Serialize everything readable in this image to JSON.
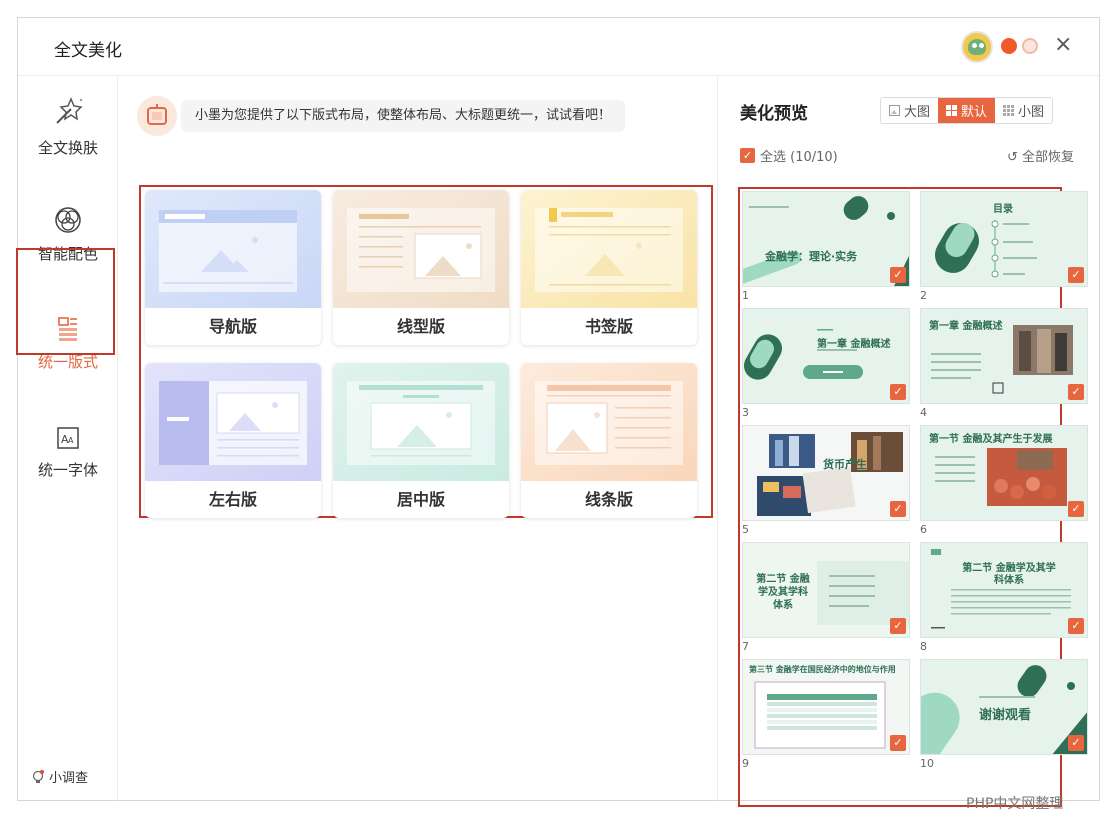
{
  "window": {
    "title": "全文美化"
  },
  "sidebar": {
    "items": [
      {
        "label": "全文换肤",
        "icon": "magic-wand-icon"
      },
      {
        "label": "智能配色",
        "icon": "color-circles-icon"
      },
      {
        "label": "统一版式",
        "icon": "layout-icon"
      },
      {
        "label": "统一字体",
        "icon": "font-icon"
      }
    ],
    "survey_label": "小调查"
  },
  "tip": {
    "text": "小墨为您提供了以下版式布局，使整体布局、大标题更统一，试试看吧！"
  },
  "layouts": [
    {
      "label": "导航版"
    },
    {
      "label": "线型版"
    },
    {
      "label": "书签版"
    },
    {
      "label": "左右版"
    },
    {
      "label": "居中版"
    },
    {
      "label": "线条版"
    }
  ],
  "preview": {
    "title": "美化预览",
    "view_options": [
      "大图",
      "默认",
      "小图"
    ],
    "selected_view": "默认",
    "select_all_label": "全选 (10/10)",
    "restore_label": "全部恢复",
    "slides": [
      {
        "num": "1",
        "title": "金融学：理论·实务"
      },
      {
        "num": "2",
        "title": "目录"
      },
      {
        "num": "3",
        "title": "第一章 金融概述"
      },
      {
        "num": "4",
        "title": "第一章 金融概述"
      },
      {
        "num": "5",
        "title": "货币产生"
      },
      {
        "num": "6",
        "title": "第一节 金融及其产生于发展"
      },
      {
        "num": "7",
        "title": "第二节 金融学及其学科体系"
      },
      {
        "num": "8",
        "title": "第二节 金融学及其学科体系"
      },
      {
        "num": "9",
        "title": "第三节 金融学在国民经济中的地位与作用"
      },
      {
        "num": "10",
        "title": "谢谢观看"
      }
    ]
  },
  "watermark": "PHP中文网整理",
  "colors": {
    "accent": "#e8663f",
    "highlight_box": "#c0392b"
  }
}
